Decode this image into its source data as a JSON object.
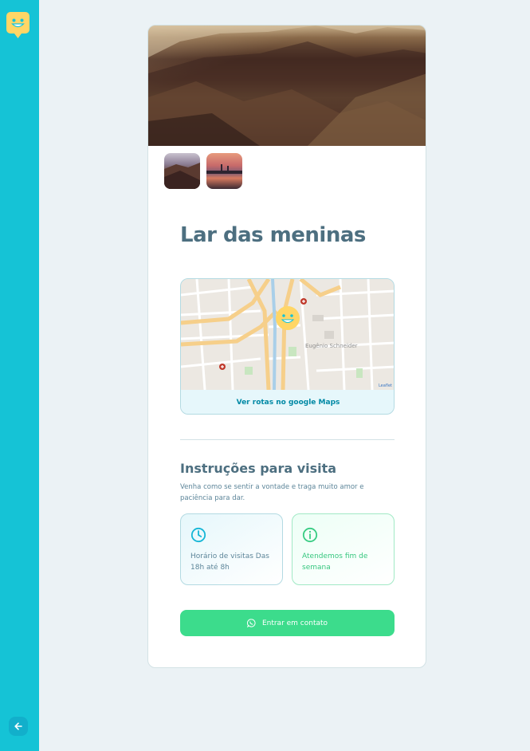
{
  "sidebar": {
    "logo_icon": "happy-pin-logo-icon",
    "back_icon": "arrow-left-icon"
  },
  "orphanage": {
    "name": "Lar das meninas",
    "map_link_label": "Ver rotas no google Maps",
    "map_place_label": "Eugênio Schneider",
    "map_attribution": "Leaflet",
    "instructions_title": "Instruções para visita",
    "instructions_text": "Venha como se sentir a vontade e traga muito amor e paciência para dar.",
    "opening_hours": "Horário de visitas Das 18h até 8h",
    "weekend_info": "Atendemos fim de semana",
    "contact_button_label": "Entrar em contato"
  },
  "colors": {
    "sidebar": "#15c3d6",
    "title": "#4d6f80",
    "accent_green": "#3cdc8c",
    "map_link": "#0089a5"
  }
}
